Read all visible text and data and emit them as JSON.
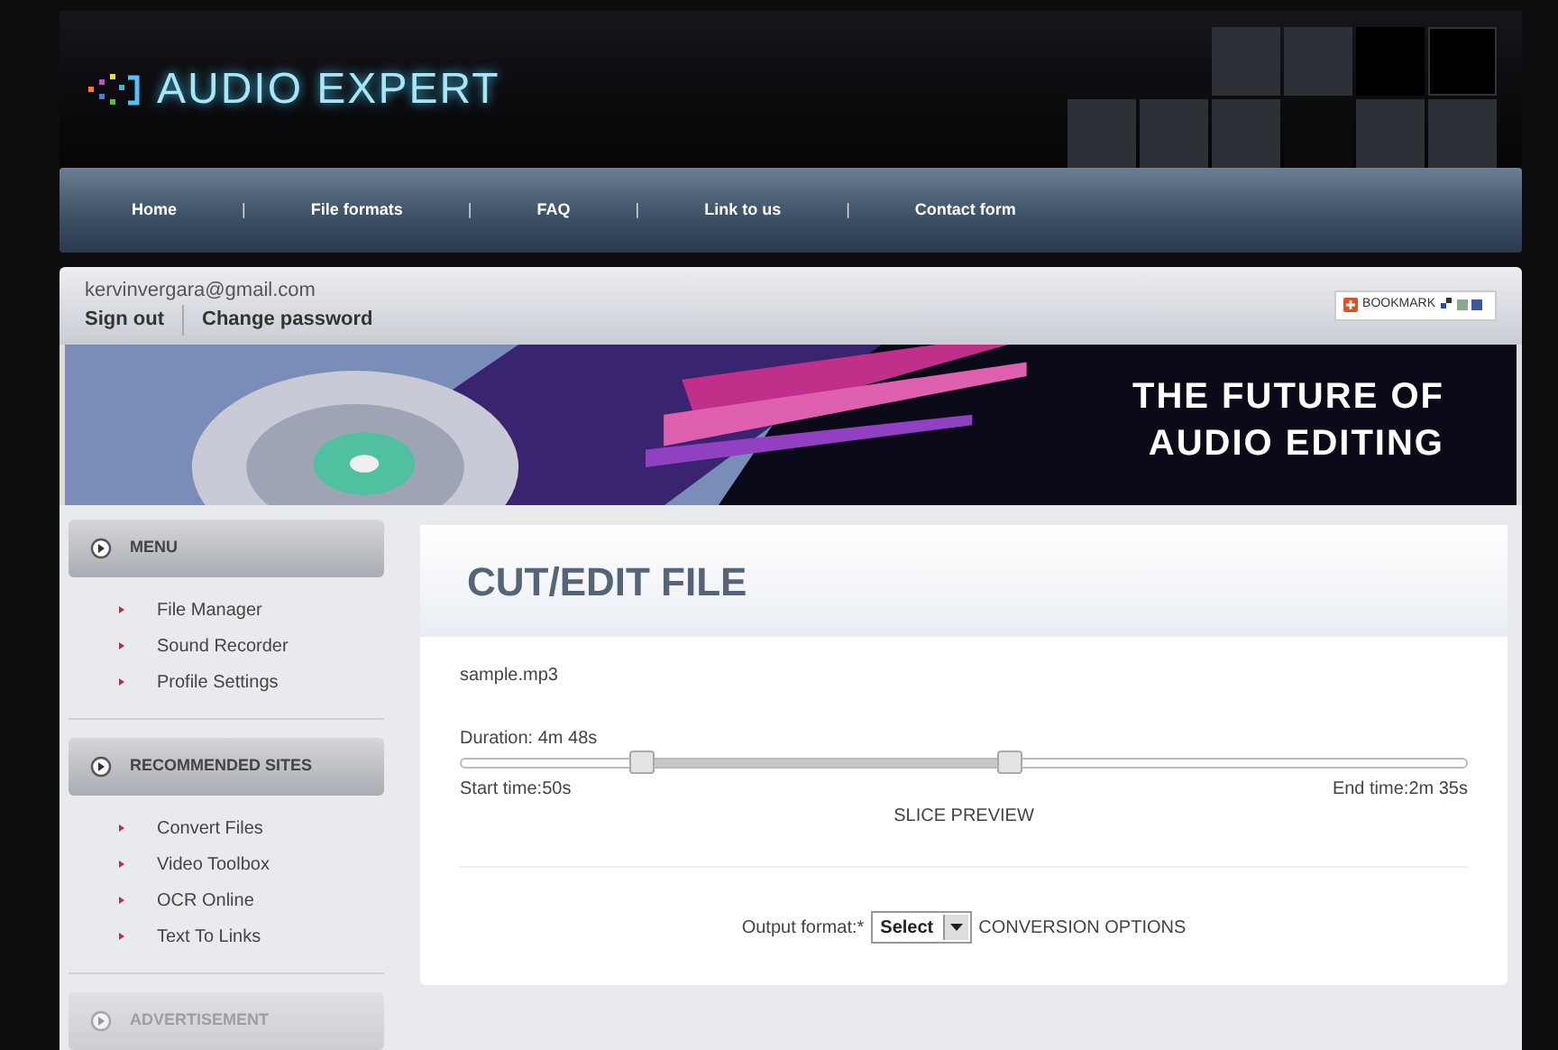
{
  "logo": {
    "text": "AUDIO EXPERT"
  },
  "nav": [
    {
      "label": "Home"
    },
    {
      "label": "File formats"
    },
    {
      "label": "FAQ"
    },
    {
      "label": "Link to us"
    },
    {
      "label": "Contact form"
    }
  ],
  "nav_separator": "|",
  "user": {
    "email": "kervinvergara@gmail.com",
    "links": [
      {
        "label": "Sign out"
      },
      {
        "label": "Change password"
      }
    ]
  },
  "bookmark": {
    "label": "BOOKMARK"
  },
  "banner": {
    "lines": [
      "THE FUTURE OF",
      "AUDIO EDITING"
    ]
  },
  "sidebar": [
    {
      "title": "MENU",
      "faded": false,
      "items": [
        {
          "label": "File Manager"
        },
        {
          "label": "Sound Recorder"
        },
        {
          "label": "Profile Settings"
        }
      ]
    },
    {
      "title": "RECOMMENDED SITES",
      "faded": false,
      "items": [
        {
          "label": "Convert Files"
        },
        {
          "label": "Video Toolbox"
        },
        {
          "label": "OCR Online"
        },
        {
          "label": "Text To Links"
        }
      ]
    },
    {
      "title": "ADVERTISEMENT",
      "faded": true
    }
  ],
  "main": {
    "title": "CUT/EDIT FILE",
    "filename": "sample.mp3",
    "duration": "Duration: 4m 48s",
    "slider": {
      "thumbs": [
        {
          "level": 0.18
        },
        {
          "level": 0.545
        }
      ]
    },
    "start_time": "Start time:50s",
    "end_time": "End time:2m 35s",
    "preview": "SLICE PREVIEW",
    "output_label": "Output format:*",
    "output_value": "Select",
    "options_link": "CONVERSION OPTIONS"
  }
}
